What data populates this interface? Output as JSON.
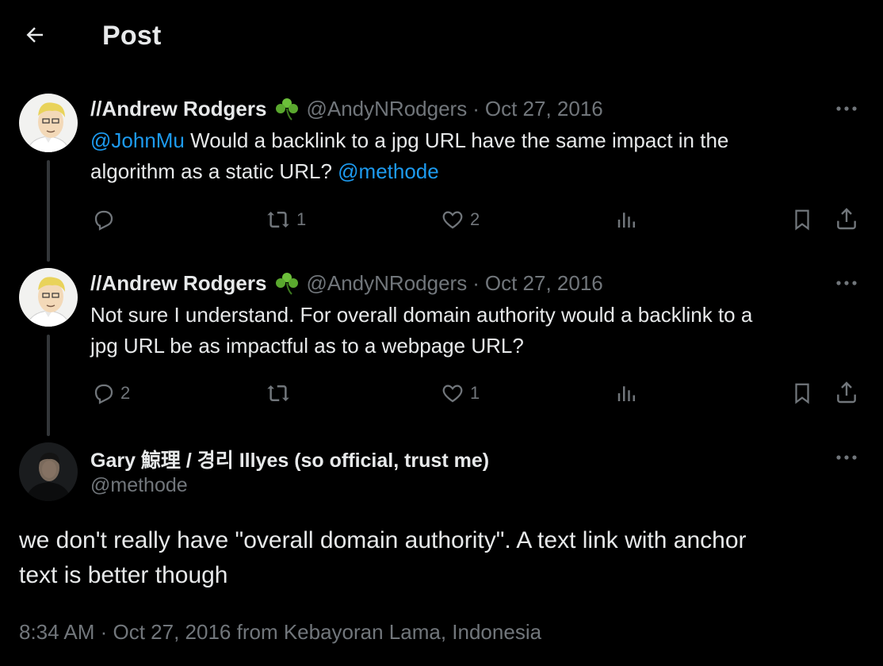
{
  "header": {
    "title": "Post",
    "back_icon": "arrow-left-icon"
  },
  "tweets": [
    {
      "author": "//Andrew Rodgers",
      "emoji": "shamrock",
      "handle": "@AndyNRodgers",
      "separator": "·",
      "date": "Oct 27, 2016",
      "mention1": "@JohnMu",
      "text_line1": " Would a backlink to a jpg URL have the same impact in the",
      "text_line2": "algorithm as a static URL? ",
      "mention2": "@methode",
      "replies": "",
      "reposts": "1",
      "likes": "2",
      "views": ""
    },
    {
      "author": "//Andrew Rodgers",
      "emoji": "shamrock",
      "handle": "@AndyNRodgers",
      "separator": "·",
      "date": "Oct 27, 2016",
      "text_line1": "Not sure I understand. For overall domain authority would a backlink to a",
      "text_line2": "jpg URL be as impactful as to a webpage URL?",
      "replies": "2",
      "reposts": "",
      "likes": "1",
      "views": ""
    }
  ],
  "main_post": {
    "author": "Gary 鯨理 / 경리 Illyes (so official, trust me)",
    "handle": "@methode",
    "text_line1": "we don't really have \"overall domain authority\". A text link with anchor",
    "text_line2": "text is better though",
    "timestamp": "8:34 AM · Oct 27, 2016 from Kebayoran Lama, Indonesia"
  },
  "colors": {
    "background": "#000000",
    "text": "#e7e9ea",
    "muted": "#71767b",
    "link": "#1d9bf0",
    "thread_line": "#333639"
  }
}
